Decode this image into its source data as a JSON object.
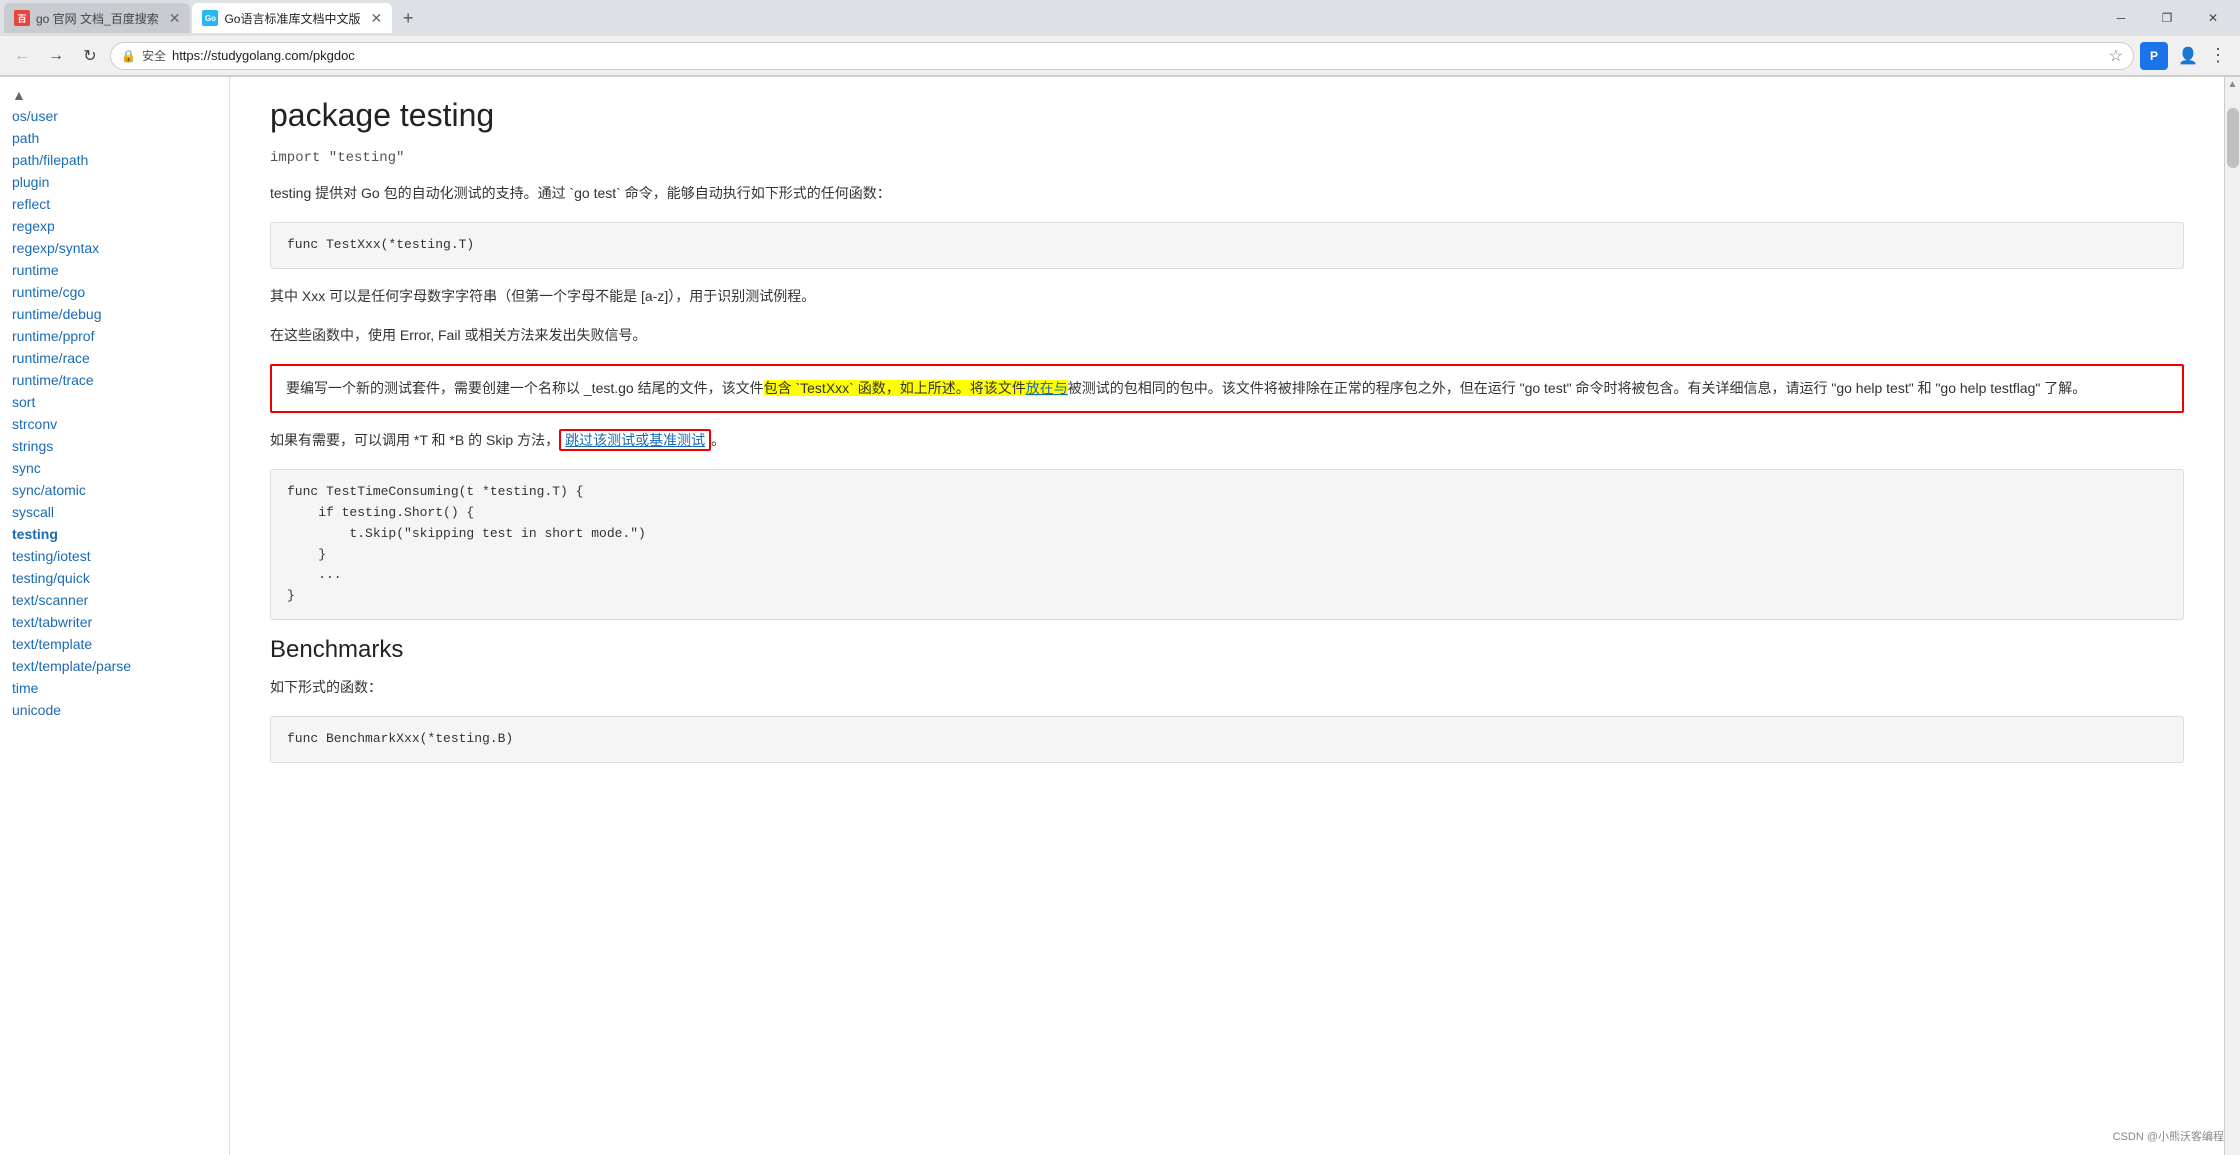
{
  "browser": {
    "tabs": [
      {
        "id": "tab1",
        "label": "go 官网 文档_百度搜索",
        "favicon_color": "#e8453c",
        "favicon_letter": "百",
        "active": false
      },
      {
        "id": "tab2",
        "label": "Go语言标准库文档中文版",
        "favicon_color": "#29b6f6",
        "favicon_letter": "Go",
        "active": true
      }
    ],
    "url": "https://studygolang.com/pkgdoc",
    "security_label": "安全",
    "new_tab_label": "+",
    "back_disabled": false,
    "forward_disabled": true
  },
  "sidebar": {
    "items": [
      {
        "label": "os/user",
        "href": "os/user"
      },
      {
        "label": "path",
        "href": "path"
      },
      {
        "label": "path/filepath",
        "href": "path/filepath"
      },
      {
        "label": "plugin",
        "href": "plugin"
      },
      {
        "label": "reflect",
        "href": "reflect"
      },
      {
        "label": "regexp",
        "href": "regexp"
      },
      {
        "label": "regexp/syntax",
        "href": "regexp/syntax"
      },
      {
        "label": "runtime",
        "href": "runtime"
      },
      {
        "label": "runtime/cgo",
        "href": "runtime/cgo"
      },
      {
        "label": "runtime/debug",
        "href": "runtime/debug"
      },
      {
        "label": "runtime/pprof",
        "href": "runtime/pprof"
      },
      {
        "label": "runtime/race",
        "href": "runtime/race"
      },
      {
        "label": "runtime/trace",
        "href": "runtime/trace"
      },
      {
        "label": "sort",
        "href": "sort"
      },
      {
        "label": "strconv",
        "href": "strconv"
      },
      {
        "label": "strings",
        "href": "strings"
      },
      {
        "label": "sync",
        "href": "sync"
      },
      {
        "label": "sync/atomic",
        "href": "sync/atomic"
      },
      {
        "label": "syscall",
        "href": "syscall"
      },
      {
        "label": "testing",
        "href": "testing",
        "active": true
      },
      {
        "label": "testing/iotest",
        "href": "testing/iotest"
      },
      {
        "label": "testing/quick",
        "href": "testing/quick"
      },
      {
        "label": "text/scanner",
        "href": "text/scanner"
      },
      {
        "label": "text/tabwriter",
        "href": "text/tabwriter"
      },
      {
        "label": "text/template",
        "href": "text/template"
      },
      {
        "label": "text/template/parse",
        "href": "text/template/parse"
      },
      {
        "label": "time",
        "href": "time"
      },
      {
        "label": "unicode",
        "href": "unicode"
      }
    ]
  },
  "doc": {
    "package_prefix": "package ",
    "package_name": "testing",
    "import_statement": "import \"testing\"",
    "description1": "testing 提供对 Go 包的自动化测试的支持。通过 `go test` 命令，能够自动执行如下形式的任何函数：",
    "code1": "func TestXxx(*testing.T)",
    "description2": "其中 Xxx 可以是任何字母数字字符串（但第一个字母不能是 [a-z]），用于识别测试例程。",
    "description3": "在这些函数中，使用 Error, Fail 或相关方法来发出失败信号。",
    "highlighted_text1": "要编写一个新的测试套件，需要创建一个名称以 _test.go 结尾的文件，该文件包含 `TestXxx` 函数，如上所述。将该文件放在与被测试的包相同的包中。该文件将被排除在正常的程序包之外，但在运行 \"go test\" 命令时将被包含。有关详细信息，请运行 \"go help test\" 和 \"go help testflag\" 了解。",
    "description4_pre": "如果有需要，可以调用 *T 和 *B 的 Skip 方法，",
    "description4_link": "跳过该测试或基准测试",
    "description4_post": "。",
    "code2_lines": [
      "func TestTimeConsuming(t *testing.T) {",
      "    if testing.Short() {",
      "        t.Skip(\"skipping test in short mode.\")",
      "    }",
      "    ...",
      "}"
    ],
    "benchmarks_title": "Benchmarks",
    "benchmarks_desc": "如下形式的函数：",
    "code3": "func BenchmarkXxx(*testing.B)"
  },
  "watermark": "CSDN @小熊沃客编程"
}
